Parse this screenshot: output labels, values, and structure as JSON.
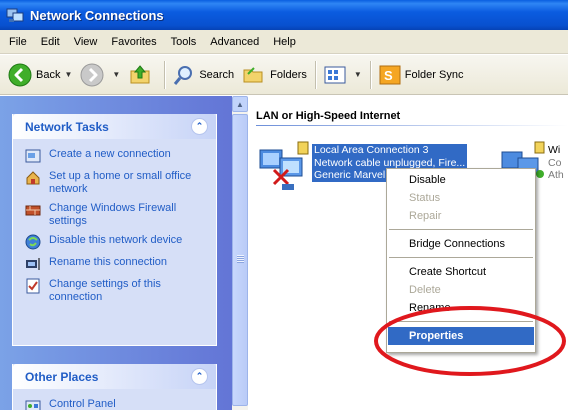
{
  "window": {
    "title": "Network Connections"
  },
  "menu": [
    "File",
    "Edit",
    "View",
    "Favorites",
    "Tools",
    "Advanced",
    "Help"
  ],
  "toolbar": {
    "back": "Back",
    "search": "Search",
    "folders": "Folders",
    "folder_sync": "Folder Sync"
  },
  "network_tasks": {
    "title": "Network Tasks",
    "items": [
      "Create a new connection",
      "Set up a home or small office network",
      "Change Windows Firewall settings",
      "Disable this network device",
      "Rename this connection",
      "Change settings of this connection"
    ]
  },
  "other_places": {
    "title": "Other Places",
    "items": [
      "Control Panel"
    ]
  },
  "group": {
    "title": "LAN or High-Speed Internet"
  },
  "connections": [
    {
      "name": "Local Area Connection 3",
      "status": "Network cable unplugged, Fire...",
      "device": "Generic Marvel..."
    },
    {
      "name": "Wi",
      "status": "Co",
      "device": "Ath"
    }
  ],
  "context_menu": {
    "items": [
      {
        "label": "Disable",
        "enabled": true
      },
      {
        "label": "Status",
        "enabled": false
      },
      {
        "label": "Repair",
        "enabled": false
      },
      {
        "label": "Bridge Connections",
        "enabled": true
      },
      {
        "label": "Create Shortcut",
        "enabled": true
      },
      {
        "label": "Delete",
        "enabled": false
      },
      {
        "label": "Rename",
        "enabled": true
      },
      {
        "label": "Properties",
        "enabled": true,
        "selected": true
      }
    ]
  },
  "colors": {
    "title_bar": "#0a5fe0",
    "task_pane": "#6375d6",
    "link": "#215dc6",
    "selection": "#316ac5",
    "highlight_ring": "#e0181d"
  }
}
